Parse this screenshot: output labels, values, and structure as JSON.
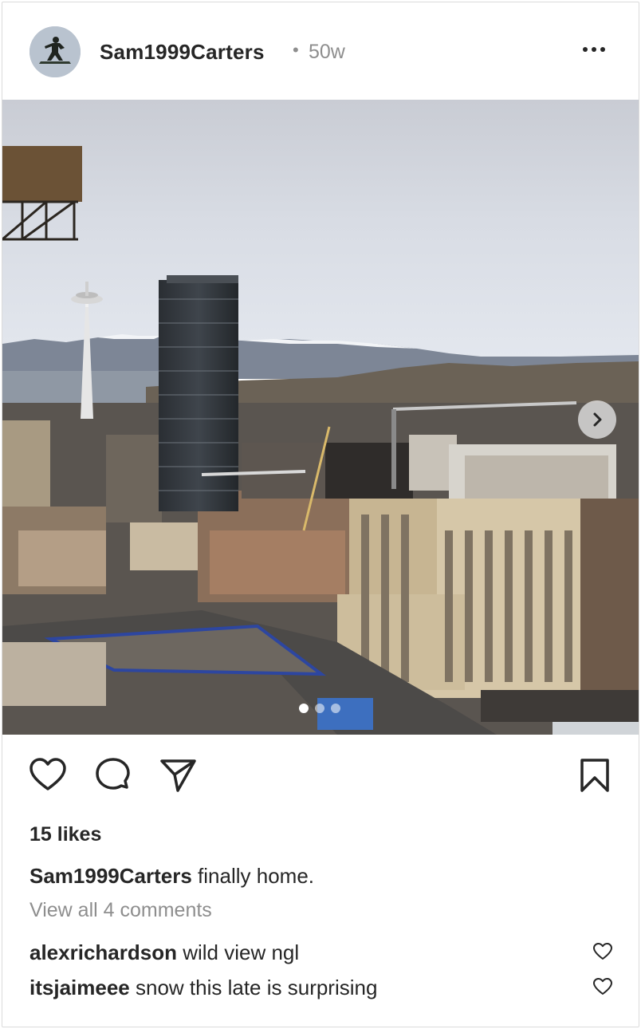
{
  "post": {
    "username": "Sam1999Carters",
    "separator": "•",
    "timestamp": "50w",
    "likes": "15 likes",
    "caption_user": "Sam1999Carters",
    "caption_text": "finally home.",
    "view_all": "View all 4 comments",
    "carousel": {
      "count": 3,
      "active_index": 0
    },
    "comments": [
      {
        "user": "alexrichardson",
        "text": "wild view ngl"
      },
      {
        "user": "itsjaimeee",
        "text": "snow this late is surprising"
      }
    ]
  },
  "icons": {
    "more": "more-horizontal-icon",
    "like": "heart-icon",
    "comment": "comment-bubble-icon",
    "share": "paper-plane-icon",
    "save": "bookmark-icon",
    "next": "chevron-right-icon"
  },
  "colors": {
    "text": "#262626",
    "secondary": "#8e8e8e",
    "border": "#dbdbdb"
  }
}
